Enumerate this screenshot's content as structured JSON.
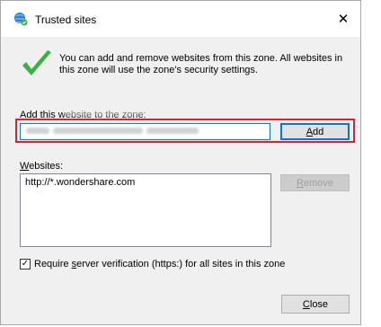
{
  "window": {
    "title": "Trusted sites",
    "close_glyph": "✕"
  },
  "info": {
    "text": "You can add and remove websites from this zone. All websites in this zone will use the zone's security settings."
  },
  "add_section": {
    "label": "Add this website to the zone:",
    "input_value": "",
    "add_button": {
      "prefix": "",
      "accel": "A",
      "suffix": "dd"
    }
  },
  "websites": {
    "label_accel": "W",
    "label_rest": "ebsites:",
    "items": [
      "http://*.wondershare.com"
    ],
    "remove_button": {
      "accel": "R",
      "suffix": "emove"
    }
  },
  "require": {
    "checked": true,
    "check_glyph": "✓",
    "prefix": "Require ",
    "accel": "s",
    "suffix": "erver verification (https:) for all sites in this zone"
  },
  "close_button": {
    "accel": "C",
    "suffix": "lose"
  },
  "colors": {
    "highlight": "#e0202a",
    "focus": "#0078d7",
    "checkmark": "#3cb044"
  }
}
